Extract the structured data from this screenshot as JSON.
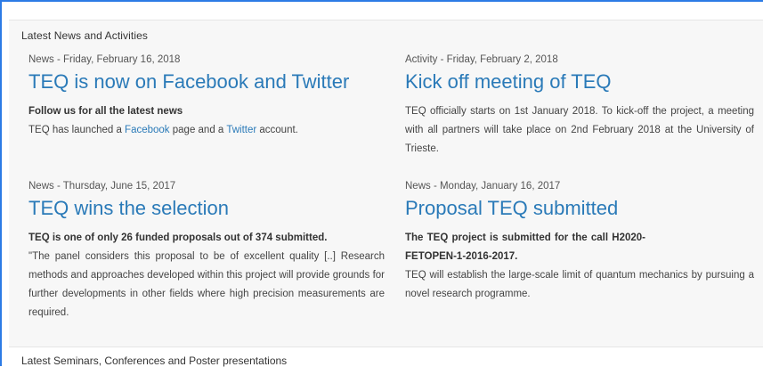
{
  "section_news": {
    "title": "Latest News and Activities"
  },
  "items": [
    {
      "meta": "News - Friday, February 16, 2018",
      "headline": "TEQ is now on Facebook and Twitter",
      "lead": "Follow us for all the latest news",
      "text_before": "TEQ has launched a ",
      "link1": "Facebook",
      "text_mid": " page and a ",
      "link2": "Twitter",
      "text_after": " account."
    },
    {
      "meta": "Activity - Friday, February 2, 2018",
      "headline": "Kick off meeting of TEQ",
      "text": "TEQ officially starts on 1st January 2018. To kick-off the project, a meeting with all partners will take place on 2nd February 2018 at the University of Trieste."
    },
    {
      "meta": "News - Thursday, June 15, 2017",
      "headline": "TEQ wins the selection",
      "lead": "TEQ is one of only 26 funded proposals out of 374 submitted.",
      "text": "\"The panel considers this proposal to be of excellent quality [..] Research methods and approaches developed within this project will provide grounds for further developments in other fields where high precision measurements are required."
    },
    {
      "meta": "News - Monday, January 16, 2017",
      "headline": "Proposal TEQ submitted",
      "lead": "The TEQ project is submitted for the call H2020-FETOPEN-1-2016-2017.",
      "text": "TEQ will establish the large-scale limit of quantum mechanics by pursuing a novel research programme."
    }
  ],
  "section_seminars": {
    "title": "Latest Seminars, Conferences and Poster presentations"
  },
  "colors": {
    "link": "#2a7ab8",
    "panel_bg": "#f7f7f7",
    "frame": "#2c7be5"
  }
}
